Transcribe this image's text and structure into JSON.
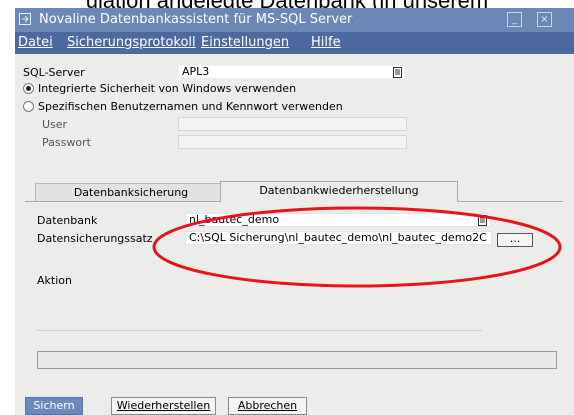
{
  "caption": "ulation angelegte Datenbank (in unserem",
  "window": {
    "title": "Novaline Datenbankassistent für MS-SQL Server",
    "minimize_glyph": "_",
    "close_glyph": "×"
  },
  "menu": {
    "items": [
      "Datei",
      "Sicherungsprotokoll",
      "Einstellungen",
      "Hilfe"
    ]
  },
  "sql": {
    "server_label": "SQL-Server",
    "server_value": "APL3",
    "radio_integrated": "Integrierte Sicherheit von Windows verwenden",
    "radio_specific": "Spezifischen Benutzernamen und Kennwort verwenden",
    "user_label": "User",
    "password_label": "Passwort",
    "user_value": "",
    "password_value": ""
  },
  "tabs": {
    "backup": "Datenbanksicherung",
    "restore": "Datenbankwiederherstellung"
  },
  "restore": {
    "db_label": "Datenbank",
    "db_value": "nl_bautec_demo",
    "backupset_label": "Datensicherungssatz",
    "backupset_value": "C:\\SQL Sicherung\\nl_bautec_demo\\nl_bautec_demo2C",
    "browse_label": "...",
    "action_label": "Aktion"
  },
  "buttons": {
    "save": "Sichern",
    "restore": "Wiederherstellen",
    "cancel": "Abbrechen"
  },
  "colors": {
    "titlebar": "#6b87b6",
    "menubar": "#4c6aa0",
    "window_bg": "#ececea",
    "annotation": "#e8141b"
  },
  "icons": [
    "window-app-icon",
    "minimize-icon",
    "close-icon",
    "dropdown-icon",
    "radio-icon"
  ]
}
